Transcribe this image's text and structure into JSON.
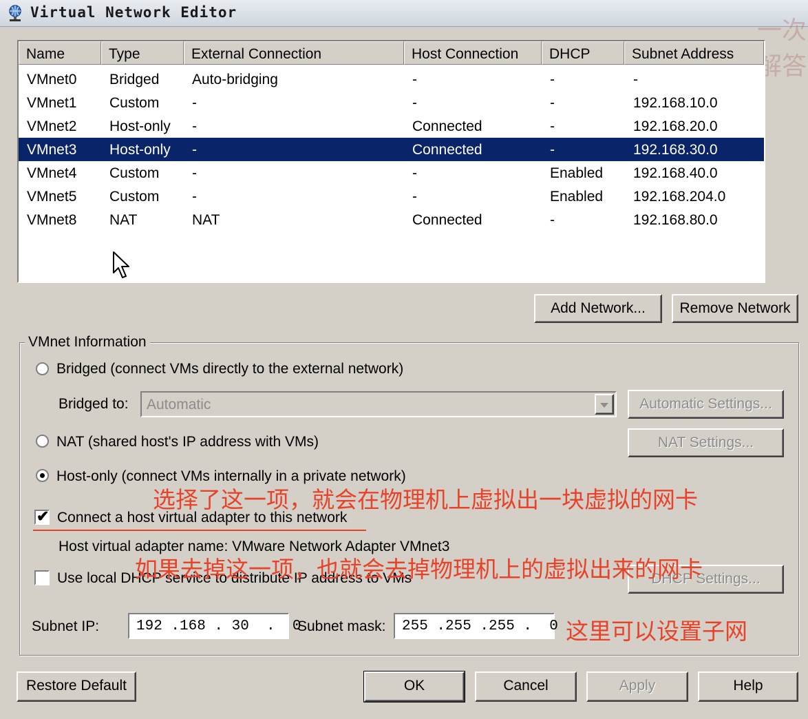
{
  "window": {
    "title": "Virtual Network Editor"
  },
  "corner_overlay": "一次\n解答",
  "table": {
    "columns": [
      "Name",
      "Type",
      "External Connection",
      "Host Connection",
      "DHCP",
      "Subnet Address"
    ],
    "rows": [
      [
        "VMnet0",
        "Bridged",
        "Auto-bridging",
        "-",
        "-",
        "-"
      ],
      [
        "VMnet1",
        "Custom",
        "-",
        "-",
        "-",
        "192.168.10.0"
      ],
      [
        "VMnet2",
        "Host-only",
        "-",
        "Connected",
        "-",
        "192.168.20.0"
      ],
      [
        "VMnet3",
        "Host-only",
        "-",
        "Connected",
        "-",
        "192.168.30.0"
      ],
      [
        "VMnet4",
        "Custom",
        "-",
        "-",
        "Enabled",
        "192.168.40.0"
      ],
      [
        "VMnet5",
        "Custom",
        "-",
        "-",
        "Enabled",
        "192.168.204.0"
      ],
      [
        "VMnet8",
        "NAT",
        "NAT",
        "Connected",
        "-",
        "192.168.80.0"
      ]
    ],
    "selected_row": "VMnet3"
  },
  "buttons": {
    "add_network": "Add Network...",
    "remove_network": "Remove Network",
    "automatic_settings": "Automatic Settings...",
    "nat_settings": "NAT Settings...",
    "dhcp_settings": "DHCP Settings...",
    "restore_default": "Restore Default",
    "ok": "OK",
    "cancel": "Cancel",
    "apply": "Apply",
    "help": "Help"
  },
  "vmnet_info": {
    "group_label": "VMnet Information",
    "bridged_label": "Bridged (connect VMs directly to the external network)",
    "bridged_to_label": "Bridged to:",
    "bridged_to_value": "Automatic",
    "nat_label": "NAT (shared host's IP address with VMs)",
    "hostonly_label": "Host-only (connect VMs internally in a private network)",
    "selected_mode": "Host-only",
    "connect_adapter_label": "Connect a host virtual adapter to this network",
    "connect_adapter_checked": true,
    "adapter_name_text": "Host virtual adapter name: VMware Network Adapter VMnet3",
    "dhcp_label": "Use local DHCP service to distribute IP address to VMs",
    "dhcp_checked": false,
    "subnet_ip_label": "Subnet IP:",
    "subnet_ip_value": "192 .168 . 30  .  0",
    "subnet_mask_label": "Subnet mask:",
    "subnet_mask_value": "255 .255 .255 .  0"
  },
  "annotations": {
    "note1": "选择了这一项，就会在物理机上虚拟出一块虚拟的网卡",
    "note2": "如果去掉这一项，也就会去掉物理机上的虚拟出来的网卡",
    "note3": "这里可以设置子网"
  },
  "colors": {
    "selection": "#0a246a",
    "annotation": "#e8432a",
    "dialog_bg": "#d4d0c8"
  }
}
